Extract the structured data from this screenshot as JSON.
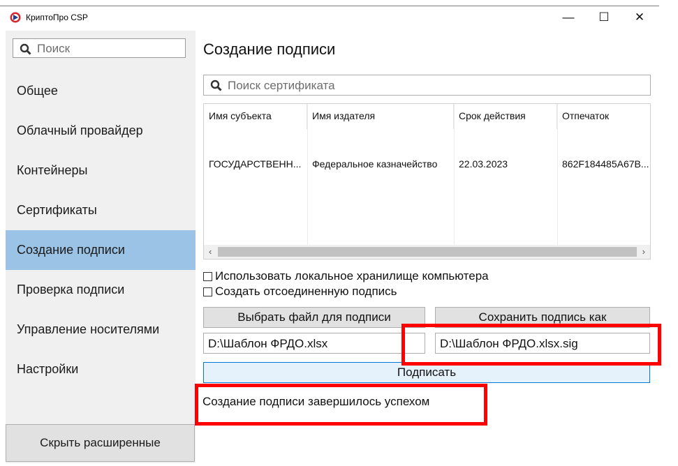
{
  "app": {
    "title": "КриптоПро CSP"
  },
  "window_controls": {
    "minimize": "—",
    "maximize": "☐",
    "close": "✕"
  },
  "sidebar": {
    "search_placeholder": "Поиск",
    "items": [
      {
        "label": "Общее",
        "active": false
      },
      {
        "label": "Облачный провайдер",
        "active": false
      },
      {
        "label": "Контейнеры",
        "active": false
      },
      {
        "label": "Сертификаты",
        "active": false
      },
      {
        "label": "Создание подписи",
        "active": true
      },
      {
        "label": "Проверка подписи",
        "active": false
      },
      {
        "label": "Управление носителями",
        "active": false
      },
      {
        "label": "Настройки",
        "active": false
      }
    ],
    "hide_button": "Скрыть расширенные"
  },
  "main": {
    "title": "Создание подписи",
    "cert_search_placeholder": "Поиск сертификата",
    "table": {
      "columns": [
        "Имя субъекта",
        "Имя издателя",
        "Срок действия",
        "Отпечаток"
      ],
      "rows": [
        [
          "ГОСУДАРСТВЕНН...",
          "Федеральное казначейство",
          "22.03.2023",
          "862F184485A67B..."
        ]
      ]
    },
    "options": {
      "use_local_store": "Использовать локальное хранилище компьютера",
      "detached_signature": "Создать отсоединенную подпись"
    },
    "choose_file_button": "Выбрать файл для подписи",
    "save_signature_button": "Сохранить подпись как",
    "source_file": "D:\\Шаблон ФРДО.xlsx",
    "signature_file": "D:\\Шаблон ФРДО.xlsx.sig",
    "sign_button": "Подписать",
    "status": "Создание подписи завершилось успехом"
  },
  "colors": {
    "accent": "#9ac3e5",
    "highlight": "#ff0000",
    "sign_button_bg": "#e5f1fb"
  }
}
